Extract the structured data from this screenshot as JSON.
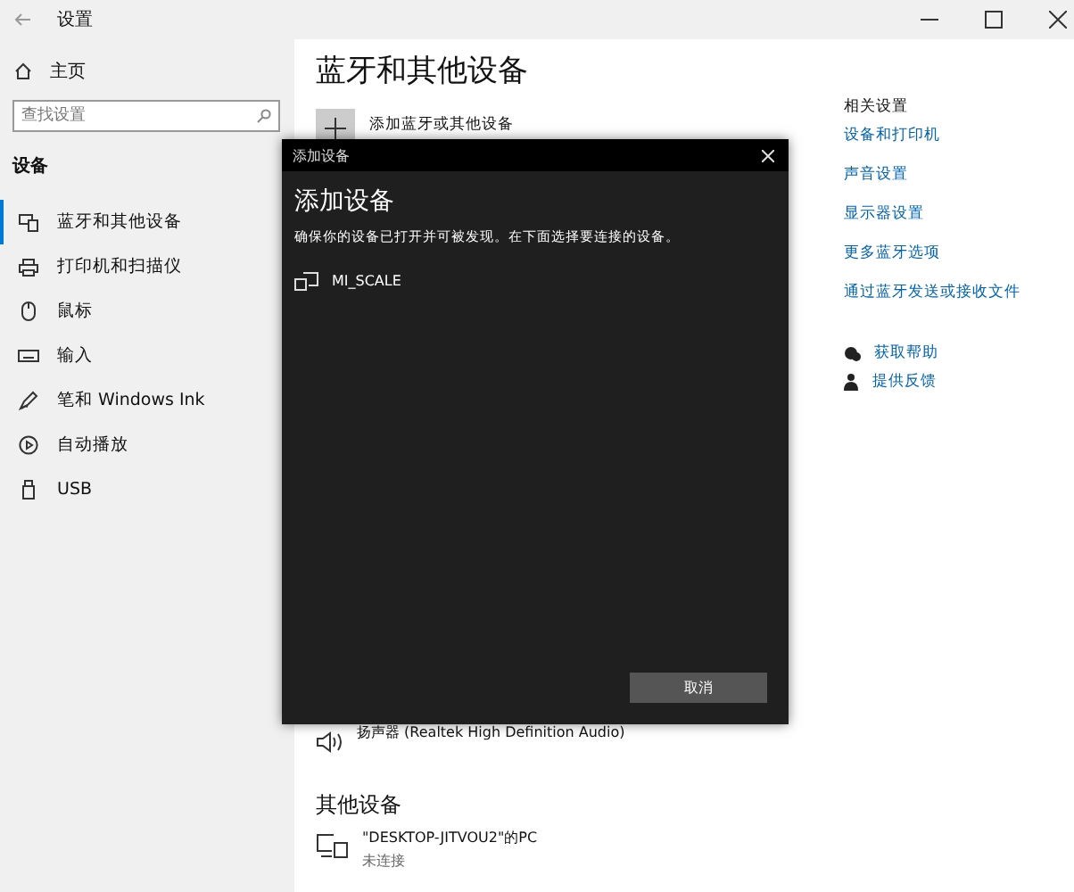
{
  "window": {
    "title": "设置"
  },
  "sidebar": {
    "home": "主页",
    "search": {
      "placeholder": "查找设置"
    },
    "section": "设备",
    "items": [
      {
        "label": "蓝牙和其他设备",
        "kind": "bluetooth",
        "selected": true
      },
      {
        "label": "打印机和扫描仪",
        "kind": "printer",
        "selected": false
      },
      {
        "label": "鼠标",
        "kind": "mouse",
        "selected": false
      },
      {
        "label": "输入",
        "kind": "keyboard",
        "selected": false
      },
      {
        "label": "笔和 Windows Ink",
        "kind": "pen",
        "selected": false
      },
      {
        "label": "自动播放",
        "kind": "autoplay",
        "selected": false
      },
      {
        "label": "USB",
        "kind": "usb",
        "selected": false
      }
    ]
  },
  "main": {
    "heading": "蓝牙和其他设备",
    "add_button": "添加蓝牙或其他设备",
    "audio_device": "扬声器 (Realtek High Definition Audio)",
    "other_heading": "其他设备",
    "other_devices": [
      {
        "name": "\"DESKTOP-JITVOU2\"的PC",
        "status": "未连接"
      }
    ]
  },
  "related": {
    "title": "相关设置",
    "links": [
      "设备和打印机",
      "声音设置",
      "显示器设置",
      "更多蓝牙选项",
      "通过蓝牙发送或接收文件"
    ],
    "help": [
      {
        "label": "获取帮助",
        "kind": "help"
      },
      {
        "label": "提供反馈",
        "kind": "feedback"
      }
    ]
  },
  "dialog": {
    "title": "添加设备",
    "heading": "添加设备",
    "message": "确保你的设备已打开并可被发现。在下面选择要连接的设备。",
    "devices": [
      {
        "name": "MI_SCALE"
      }
    ],
    "cancel": "取消"
  }
}
